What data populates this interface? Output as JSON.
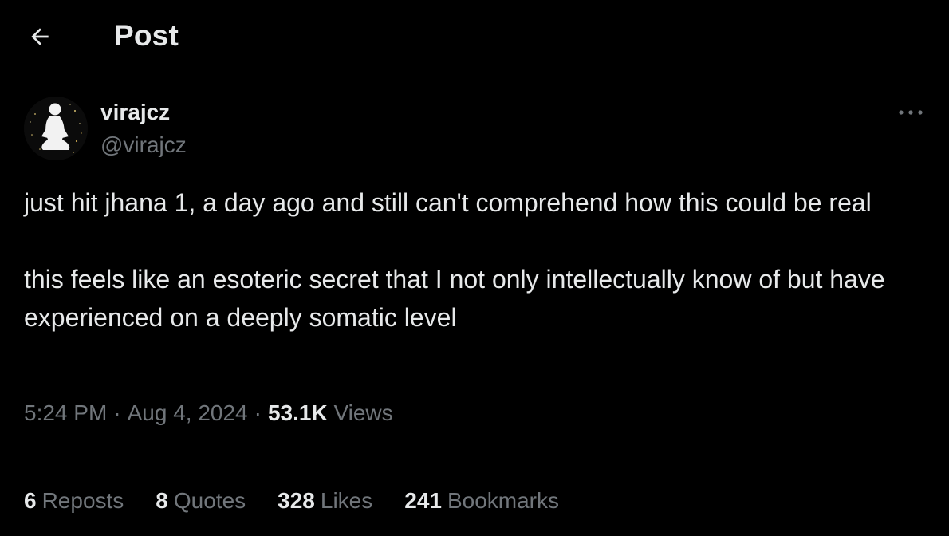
{
  "header": {
    "back_icon": "arrow-left-icon",
    "title": "Post"
  },
  "post": {
    "author": {
      "name": "virajcz",
      "handle": "@virajcz",
      "avatar_icon": "avatar-meditating-figure"
    },
    "more_icon": "ellipsis-icon",
    "text_paragraphs": [
      "just hit jhana 1, a day ago and still can't comprehend how this could be real",
      "this feels like an esoteric secret that I not only intellectually know of but have experienced on a deeply somatic level"
    ],
    "meta": {
      "time": "5:24 PM",
      "separator": "·",
      "date": "Aug 4, 2024",
      "views_count": "53.1K",
      "views_label": "Views"
    },
    "stats": {
      "reposts": {
        "count": "6",
        "label": "Reposts"
      },
      "quotes": {
        "count": "8",
        "label": "Quotes"
      },
      "likes": {
        "count": "328",
        "label": "Likes"
      },
      "bookmarks": {
        "count": "241",
        "label": "Bookmarks"
      }
    }
  },
  "colors": {
    "background": "#000000",
    "primary_text": "#e7e9ea",
    "secondary_text": "#71767b",
    "divider": "#2f3336"
  }
}
